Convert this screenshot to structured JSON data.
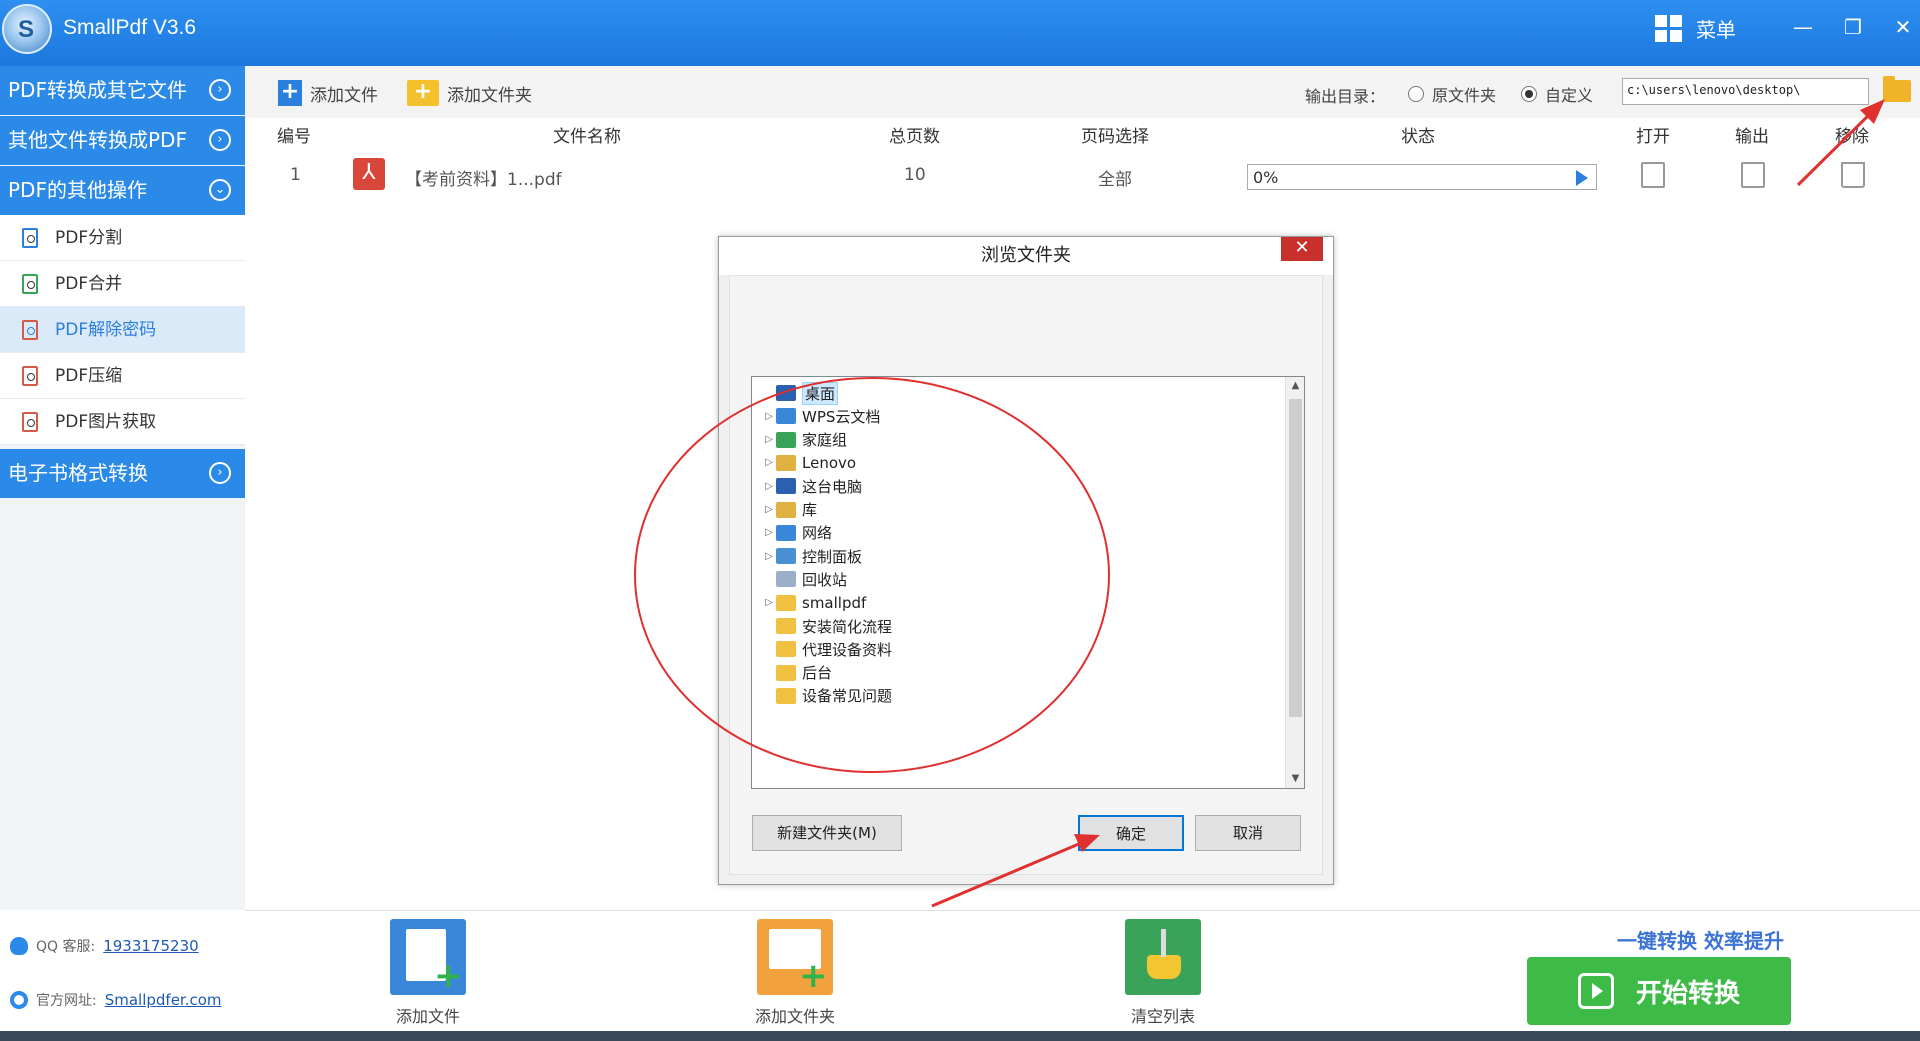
{
  "app": {
    "title": "SmallPdf V3.6",
    "logo_letter": "S",
    "menu_label": "菜单",
    "brand_color": "#2b8ae8"
  },
  "sidebar": {
    "sections": [
      {
        "label": "PDF转换成其它文件"
      },
      {
        "label": "其他文件转换成PDF"
      },
      {
        "label": "PDF的其他操作"
      },
      {
        "label": "电子书格式转换"
      }
    ],
    "items": [
      {
        "label": "PDF分割"
      },
      {
        "label": "PDF合并"
      },
      {
        "label": "PDF解除密码"
      },
      {
        "label": "PDF压缩"
      },
      {
        "label": "PDF图片获取"
      }
    ],
    "qq_label": "QQ 客服:",
    "qq_value": "1933175230",
    "site_label": "官方网址:",
    "site_value": "Smallpdfer.com"
  },
  "toolbar": {
    "add_file": "添加文件",
    "add_folder": "添加文件夹",
    "output_label": "输出目录：",
    "radio_original": "原文件夹",
    "radio_custom": "自定义",
    "output_path": "c:\\users\\lenovo\\desktop\\"
  },
  "table": {
    "headers": [
      "编号",
      "文件名称",
      "总页数",
      "页码选择",
      "状态",
      "打开",
      "输出",
      "移除"
    ],
    "rows": [
      {
        "index": "1",
        "name": "【考前资料】1...pdf",
        "pages": "10",
        "range": "全部",
        "progress": "0%"
      }
    ]
  },
  "dialog": {
    "title": "浏览文件夹",
    "tree": [
      {
        "label": "桌面",
        "icon": "desktop-icon",
        "expandable": false,
        "selected": true
      },
      {
        "label": "WPS云文档",
        "icon": "cloud-icon",
        "expandable": true
      },
      {
        "label": "家庭组",
        "icon": "homegroup-icon",
        "expandable": true
      },
      {
        "label": "Lenovo",
        "icon": "user-folder-icon",
        "expandable": true
      },
      {
        "label": "这台电脑",
        "icon": "computer-icon",
        "expandable": true
      },
      {
        "label": "库",
        "icon": "library-icon",
        "expandable": true
      },
      {
        "label": "网络",
        "icon": "network-icon",
        "expandable": true
      },
      {
        "label": "控制面板",
        "icon": "control-panel-icon",
        "expandable": true
      },
      {
        "label": "回收站",
        "icon": "recycle-bin-icon",
        "expandable": false
      },
      {
        "label": "smallpdf",
        "icon": "folder-icon",
        "expandable": true
      },
      {
        "label": "安装简化流程",
        "icon": "folder-icon",
        "expandable": false
      },
      {
        "label": "代理设备资料",
        "icon": "folder-icon",
        "expandable": false
      },
      {
        "label": "后台",
        "icon": "folder-icon",
        "expandable": false
      },
      {
        "label": "设备常见问题",
        "icon": "folder-icon",
        "expandable": false
      }
    ],
    "new_folder": "新建文件夹(M)",
    "ok": "确定",
    "cancel": "取消"
  },
  "bottom": {
    "add_file": "添加文件",
    "add_folder": "添加文件夹",
    "clear_list": "清空列表",
    "slogan": "一键转换  效率提升",
    "start": "开始转换",
    "start_color": "#3dbb46"
  },
  "annotation_color": "#e03030"
}
